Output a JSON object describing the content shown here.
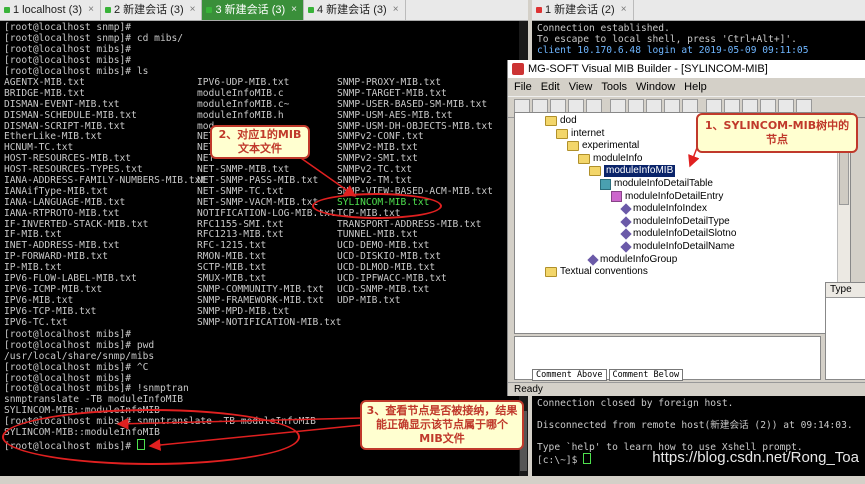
{
  "tabs_left": [
    {
      "label": "1 localhost (3)",
      "active": false,
      "lock": "green"
    },
    {
      "label": "2 新建会话 (3)",
      "active": false,
      "lock": "green"
    },
    {
      "label": "3 新建会话 (3)",
      "active": true,
      "lock": "green"
    },
    {
      "label": "4 新建会话 (3)",
      "active": false,
      "lock": "green"
    }
  ],
  "tabs_right": [
    {
      "label": "1 新建会话 (2)",
      "active": false,
      "lock": "red"
    }
  ],
  "terminal_lines": [
    "[root@localhost snmp]#",
    "[root@localhost snmp]# cd mibs/",
    "[root@localhost mibs]#",
    "[root@localhost mibs]#",
    "[root@localhost mibs]# ls"
  ],
  "ls_columns": [
    [
      "AGENTX-MIB.txt",
      "BRIDGE-MIB.txt",
      "DISMAN-EVENT-MIB.txt",
      "DISMAN-SCHEDULE-MIB.txt",
      "DISMAN-SCRIPT-MIB.txt",
      "EtherLike-MIB.txt",
      "HCNUM-TC.txt",
      "HOST-RESOURCES-MIB.txt",
      "HOST-RESOURCES-TYPES.txt",
      "IANA-ADDRESS-FAMILY-NUMBERS-MIB.txt",
      "IANAifType-MIB.txt",
      "IANA-LANGUAGE-MIB.txt",
      "IANA-RTPROTO-MIB.txt",
      "IF-INVERTED-STACK-MIB.txt",
      "IF-MIB.txt",
      "INET-ADDRESS-MIB.txt",
      "IP-FORWARD-MIB.txt",
      "IP-MIB.txt",
      "IPV6-FLOW-LABEL-MIB.txt",
      "IPV6-ICMP-MIB.txt",
      "IPV6-MIB.txt",
      "IPV6-TCP-MIB.txt",
      "IPV6-TC.txt"
    ],
    [
      "IPV6-UDP-MIB.txt",
      "moduleInfoMIB.c",
      "moduleInfoMIB.c~",
      "moduleInfoMIB.h",
      "mod",
      "NET",
      "NET",
      "NET",
      "NET-SNMP-MIB.txt",
      "NET-SNMP-PASS-MIB.txt",
      "NET-SNMP-TC.txt",
      "NET-SNMP-VACM-MIB.txt",
      "NOTIFICATION-LOG-MIB.txt",
      "RFC1155-SMI.txt",
      "RFC1213-MIB.txt",
      "RFC-1215.txt",
      "RMON-MIB.txt",
      "SCTP-MIB.txt",
      "SMUX-MIB.txt",
      "SNMP-COMMUNITY-MIB.txt",
      "SNMP-FRAMEWORK-MIB.txt",
      "SNMP-MPD-MIB.txt",
      "SNMP-NOTIFICATION-MIB.txt"
    ],
    [
      "SNMP-PROXY-MIB.txt",
      "SNMP-TARGET-MIB.txt",
      "SNMP-USER-BASED-SM-MIB.txt",
      "SNMP-USM-AES-MIB.txt",
      "SNMP-USM-DH-OBJECTS-MIB.txt",
      "SNMPv2-CONF.txt",
      "SNMPv2-MIB.txt",
      "SNMPv2-SMI.txt",
      "SNMPv2-TC.txt",
      "SNMPv2-TM.txt",
      "SNMP-VIEW-BASED-ACM-MIB.txt",
      "SYLINCOM-MIB.txt",
      "TCP-MIB.txt",
      "TRANSPORT-ADDRESS-MIB.txt",
      "TUNNEL-MIB.txt",
      "UCD-DEMO-MIB.txt",
      "UCD-DISKIO-MIB.txt",
      "UCD-DLMOD-MIB.txt",
      "UCD-IPFWACC-MIB.txt",
      "UCD-SNMP-MIB.txt",
      "UDP-MIB.txt",
      "",
      ""
    ]
  ],
  "terminal_after": [
    "[root@localhost mibs]#",
    "[root@localhost mibs]# pwd",
    "/usr/local/share/snmp/mibs",
    "[root@localhost mibs]# ^C",
    "[root@localhost mibs]#",
    "[root@localhost mibs]# !snmptran",
    "snmptranslate -TB moduleInfoMIB",
    "SYLINCOM-MIB::moduleInfoMIB",
    "[root@localhost mibs]# snmptranslate -TB moduleInfoMIB",
    "SYLINCOM-MIB::moduleInfoMIB",
    "[root@localhost mibs]# "
  ],
  "right_term_top": [
    "Connection established.",
    "To escape to local shell, press 'Ctrl+Alt+]'.",
    "client 10.170.6.48 login at 2019-05-09 09:11:05"
  ],
  "right_term_bottom": [
    "Connection closed by foreign host.",
    "",
    "Disconnected from remote host(新建会话 (2)) at 09:14:03.",
    "",
    "Type `help' to learn how to use Xshell prompt.",
    "[c:\\~]$ "
  ],
  "mib_window": {
    "title": "MG-SOFT Visual MIB Builder - [SYLINCOM-MIB]",
    "menu": [
      "File",
      "Edit",
      "View",
      "Tools",
      "Window",
      "Help"
    ],
    "tree": [
      {
        "label": "dod",
        "icon": "folder-icon",
        "indent": 0
      },
      {
        "label": "internet",
        "icon": "folder-icon",
        "indent": 1
      },
      {
        "label": "experimental",
        "icon": "folder-icon",
        "indent": 2
      },
      {
        "label": "moduleInfo",
        "icon": "folder-icon",
        "indent": 3
      },
      {
        "label": "moduleInfoMIB",
        "icon": "folder-icon",
        "indent": 4,
        "selected": true
      },
      {
        "label": "moduleInfoDetailTable",
        "icon": "table-icon",
        "indent": 5
      },
      {
        "label": "moduleInfoDetailEntry",
        "icon": "entry-icon",
        "indent": 6
      },
      {
        "label": "moduleInfoIndex",
        "icon": "leaf-icon",
        "indent": 7
      },
      {
        "label": "moduleInfoDetailType",
        "icon": "leaf-icon",
        "indent": 7
      },
      {
        "label": "moduleInfoDetailSlotno",
        "icon": "leaf-icon",
        "indent": 7
      },
      {
        "label": "moduleInfoDetailName",
        "icon": "leaf-icon",
        "indent": 7
      },
      {
        "label": "moduleInfoGroup",
        "icon": "group-icon",
        "indent": 4
      },
      {
        "label": "Textual conventions",
        "icon": "folder-icon",
        "indent": 0
      }
    ],
    "right_table_header": "Type",
    "bottom_tabs": [
      "Comment Above",
      "Comment Below"
    ],
    "status": "Ready"
  },
  "callouts": {
    "c1": "1、SYLINCOM-MIB树中的节点",
    "c2": "2、对应1的MIB文本文件",
    "c3": "3、查看节点是否被接纳，结果能正确显示该节点属于哪个MIB文件"
  },
  "watermark": "https://blog.csdn.net/Rong_Toa",
  "colors": {
    "highlight": "#4ee04e",
    "callout_border": "#c0392b",
    "selection": "#0a246a"
  }
}
